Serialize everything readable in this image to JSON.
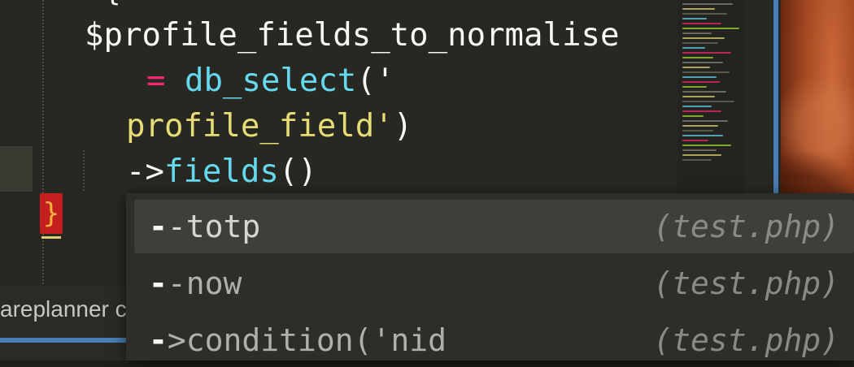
{
  "editor": {
    "code_lines": [
      {
        "parts": [
          [
            "$profile_fields_to_normalise",
            "white"
          ]
        ]
      },
      {
        "parts": [
          [
            "= ",
            "pink"
          ],
          [
            "db_select",
            "blue"
          ],
          [
            "('",
            "white"
          ]
        ]
      },
      {
        "parts": [
          [
            "profile_field'",
            "yellow"
          ],
          [
            ")",
            "white"
          ]
        ]
      },
      {
        "parts": [
          [
            "->",
            "white"
          ],
          [
            "fields",
            "blue"
          ],
          [
            "()",
            "white"
          ]
        ]
      }
    ],
    "closing_brace": "}",
    "top_brace": "{"
  },
  "status_bar": {
    "project_label": "areplanner c"
  },
  "autocomplete": {
    "items": [
      {
        "prefix": "-",
        "rest": "-totp",
        "source": "(test.php)",
        "selected": true
      },
      {
        "prefix": "-",
        "rest": "-now",
        "source": "(test.php)",
        "selected": false
      },
      {
        "prefix": "-",
        "rest": ">condition('nid",
        "source": "(test.php)",
        "selected": false
      }
    ]
  },
  "colors": {
    "accent": "#4a7db3",
    "background": "#272822",
    "pink": "#f92672",
    "blue": "#66d9ef",
    "yellow": "#e6db74"
  }
}
